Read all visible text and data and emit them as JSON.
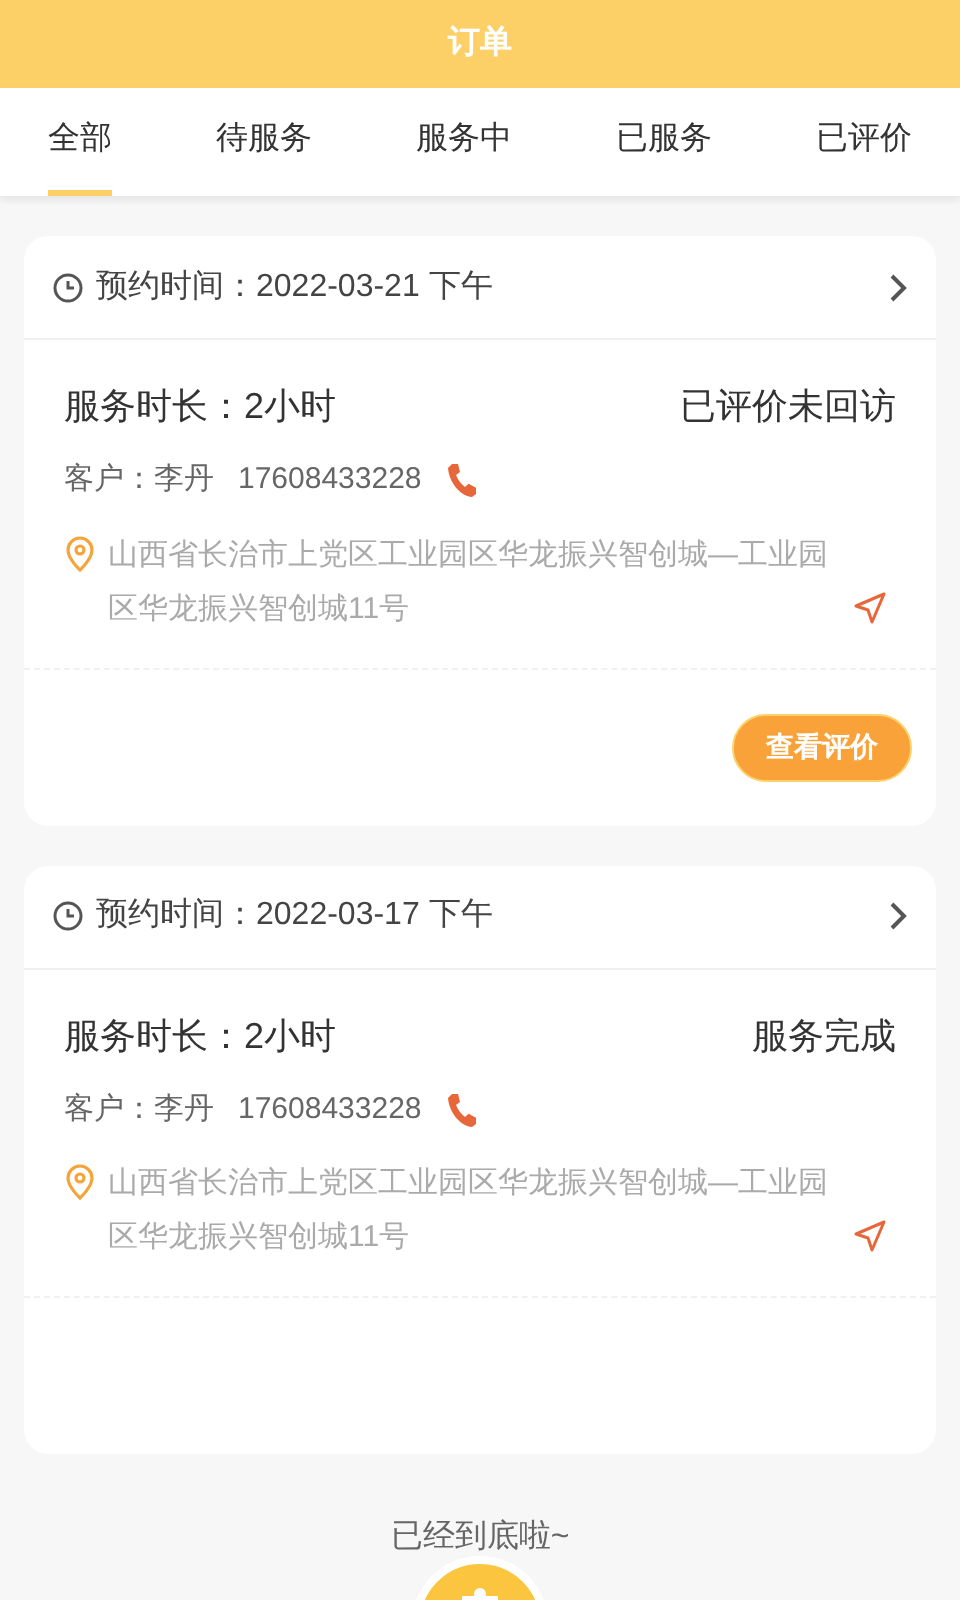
{
  "header": {
    "title": "订单"
  },
  "tabs": [
    {
      "label": "全部",
      "selected": true
    },
    {
      "label": "待服务",
      "selected": false
    },
    {
      "label": "服务中",
      "selected": false
    },
    {
      "label": "已服务",
      "selected": false
    },
    {
      "label": "已评价",
      "selected": false
    }
  ],
  "orders": [
    {
      "appointment": "预约时间：2022-03-21 下午",
      "duration": "服务时长：2小时",
      "status": "已评价未回访",
      "customer": "客户：李丹",
      "phone": "17608433228",
      "address": "山西省长治市上党区工业园区华龙振兴智创城—工业园区华龙振兴智创城11号",
      "button": "查看评价"
    },
    {
      "appointment": "预约时间：2022-03-17 下午",
      "duration": "服务时长：2小时",
      "status": "服务完成",
      "customer": "客户：李丹",
      "phone": "17608433228",
      "address": "山西省长治市上党区工业园区华龙振兴智创城—工业园区华龙振兴智创城11号"
    }
  ],
  "footer_note": "已经到底啦~"
}
